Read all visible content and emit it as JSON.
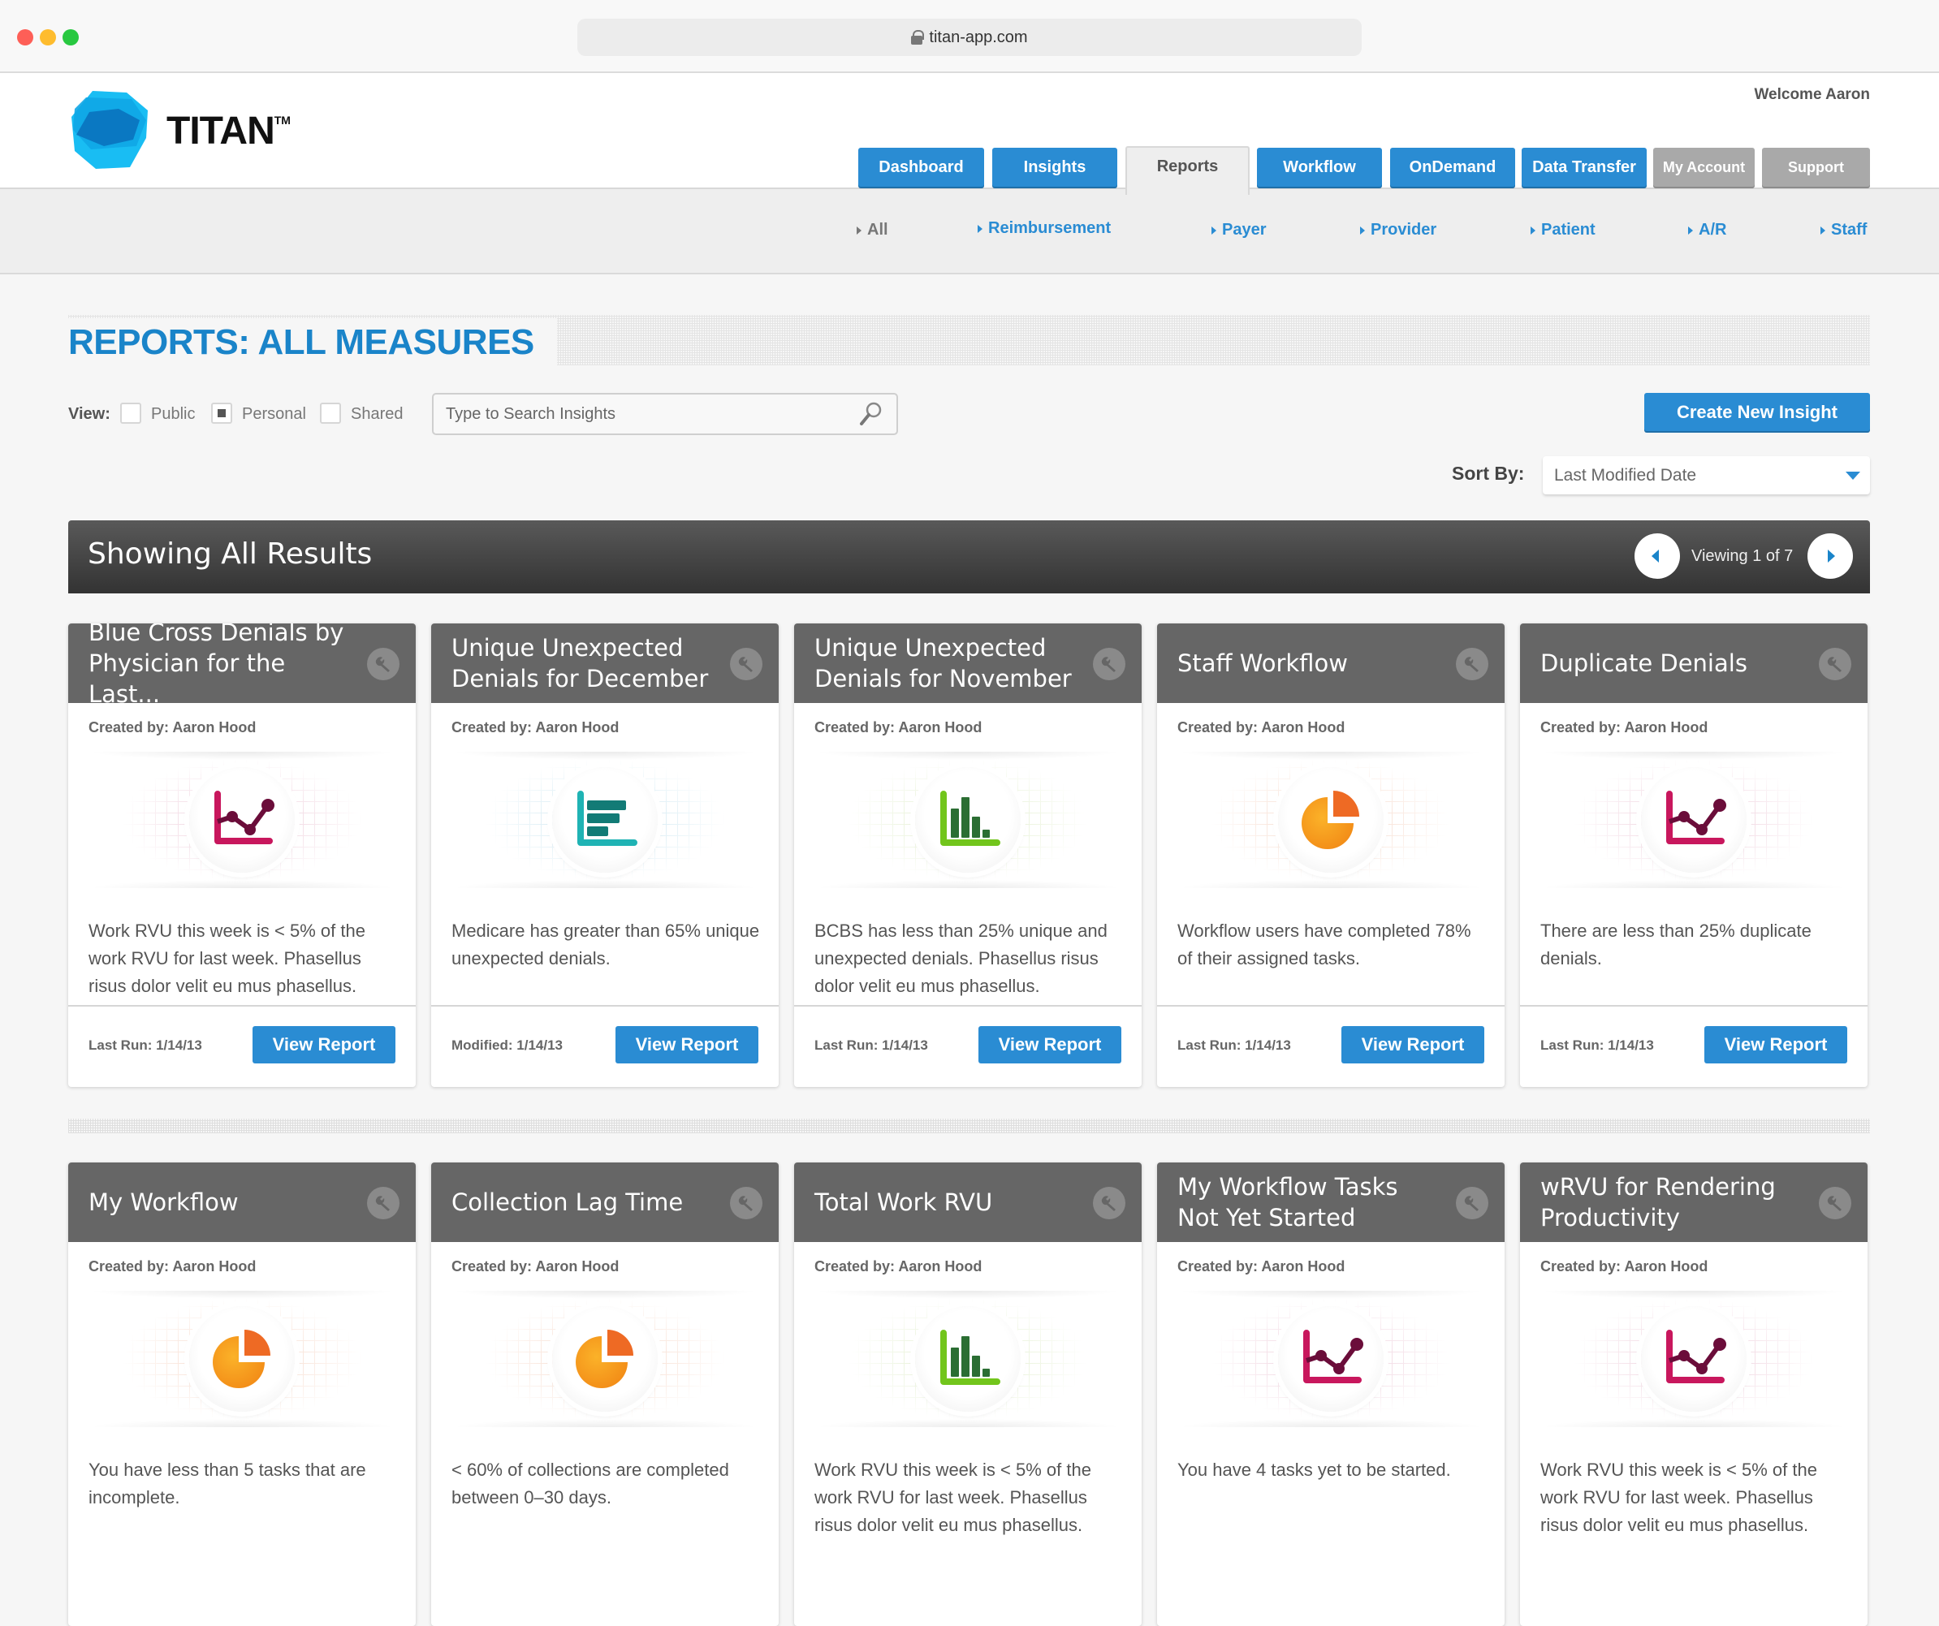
{
  "browser": {
    "url": "titan-app.com"
  },
  "header": {
    "brand": "TITAN",
    "trademark": "TM",
    "welcome": "Welcome Aaron",
    "nav": [
      {
        "label": "Dashboard",
        "state": "blue"
      },
      {
        "label": "Insights",
        "state": "blue"
      },
      {
        "label": "Reports",
        "state": "active"
      },
      {
        "label": "Workflow",
        "state": "blue"
      },
      {
        "label": "OnDemand",
        "state": "blue"
      },
      {
        "label": "Data Transfer",
        "state": "blue"
      },
      {
        "label": "My Account",
        "state": "gray"
      },
      {
        "label": "Support",
        "state": "gray"
      }
    ]
  },
  "subnav": [
    {
      "label": "All",
      "selected": true
    },
    {
      "label": "Reimbursement",
      "selected": false
    },
    {
      "label": "Payer",
      "selected": false
    },
    {
      "label": "Provider",
      "selected": false
    },
    {
      "label": "Patient",
      "selected": false
    },
    {
      "label": "A/R",
      "selected": false
    },
    {
      "label": "Staff",
      "selected": false
    }
  ],
  "page": {
    "title": "REPORTS: ALL MEASURES",
    "view_label": "View:",
    "view_options": [
      {
        "label": "Public",
        "checked": false
      },
      {
        "label": "Personal",
        "checked": true
      },
      {
        "label": "Shared",
        "checked": false
      }
    ],
    "search_placeholder": "Type to Search Insights",
    "create_button": "Create New Insight",
    "sort_label": "Sort By:",
    "sort_value": "Last Modified Date"
  },
  "results": {
    "title": "Showing All Results",
    "viewing": "Viewing 1 of 7"
  },
  "colors": {
    "accent_blue": "#2a8cd3",
    "title_blue": "#1a84c9",
    "card_header": "#666666",
    "line_icon": "#c8175d",
    "bar_h_icon": "#1aa3a8",
    "bar_v_icon": "#6cc11b",
    "pie_icon": "#f7941d"
  },
  "cards": [
    {
      "title": "Blue Cross Denials by Physician for the Last...",
      "created": "Created by: Aaron Hood",
      "icon": "line-chart",
      "desc": "Work RVU this week is < 5% of the work RVU for last week. Phasellus risus dolor velit eu mus phasellus.",
      "meta": "Last Run: 1/14/13",
      "button": "View Report"
    },
    {
      "title": "Unique Unexpected Denials for December",
      "created": "Created by: Aaron Hood",
      "icon": "horizontal-bar-chart",
      "desc": "Medicare has greater than 65% unique unexpected denials.",
      "meta": "Modified: 1/14/13",
      "button": "View Report"
    },
    {
      "title": "Unique Unexpected Denials for November",
      "created": "Created by: Aaron Hood",
      "icon": "bar-chart",
      "desc": "BCBS has less than 25% unique and unexpected denials. Phasellus risus dolor velit eu mus phasellus.",
      "meta": "Last Run: 1/14/13",
      "button": "View Report"
    },
    {
      "title": "Staff Workflow",
      "created": "Created by: Aaron Hood",
      "icon": "pie-chart",
      "desc": "Workflow users have completed 78% of their assigned tasks.",
      "meta": "Last Run: 1/14/13",
      "button": "View Report"
    },
    {
      "title": "Duplicate Denials",
      "created": "Created by: Aaron Hood",
      "icon": "line-chart",
      "desc": "There are less than 25% duplicate denials.",
      "meta": "Last Run: 1/14/13",
      "button": "View Report"
    },
    {
      "title": "My Workflow",
      "created": "Created by: Aaron Hood",
      "icon": "pie-chart",
      "desc": "You have less than 5 tasks that are incomplete.",
      "meta": "",
      "button": ""
    },
    {
      "title": "Collection Lag Time",
      "created": "Created by: Aaron Hood",
      "icon": "pie-chart",
      "desc": "< 60% of collections are completed between 0–30 days.",
      "meta": "",
      "button": ""
    },
    {
      "title": "Total Work RVU",
      "created": "Created by: Aaron Hood",
      "icon": "bar-chart",
      "desc": "Work RVU this week is < 5% of the work RVU for last week. Phasellus risus dolor velit eu mus phasellus.",
      "meta": "",
      "button": ""
    },
    {
      "title": "My Workflow Tasks Not Yet Started",
      "created": "Created by: Aaron Hood",
      "icon": "line-chart",
      "desc": "You have 4 tasks yet to be started.",
      "meta": "",
      "button": ""
    },
    {
      "title": "wRVU for Rendering Productivity",
      "created": "Created by: Aaron Hood",
      "icon": "line-chart",
      "desc": "Work RVU this week is < 5% of the work RVU for last week. Phasellus risus dolor velit eu mus phasellus.",
      "meta": "",
      "button": ""
    }
  ]
}
